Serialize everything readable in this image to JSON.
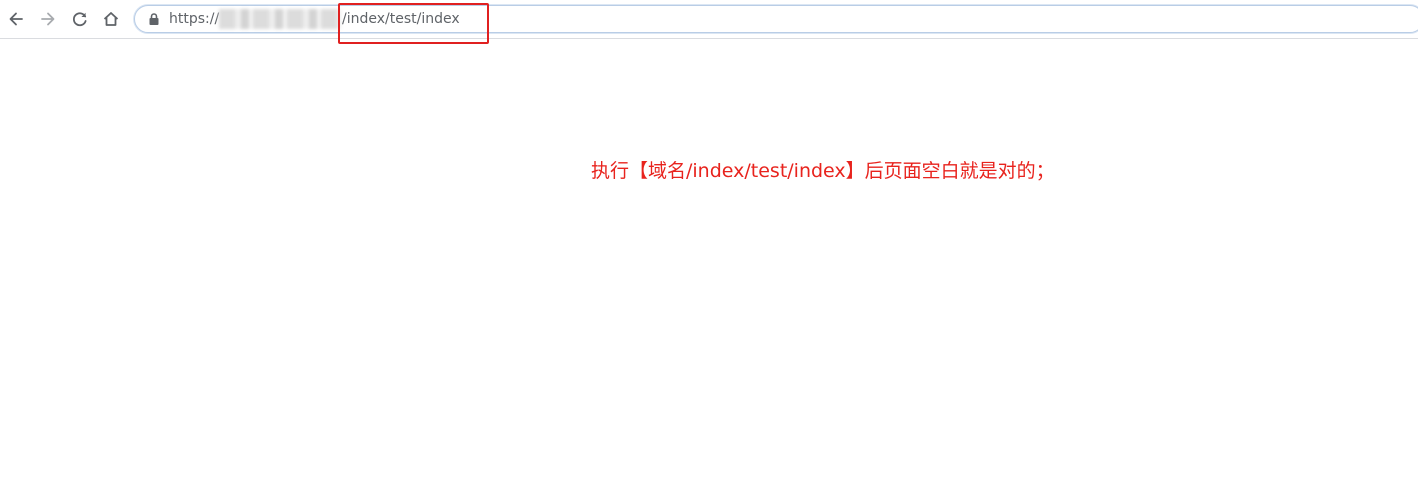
{
  "browser": {
    "icons": {
      "back": "back-arrow-icon",
      "forward": "forward-arrow-icon",
      "reload": "reload-icon",
      "home": "home-icon",
      "lock": "lock-icon"
    },
    "address_bar": {
      "scheme_prefix": "https://",
      "path": "/index/test/index"
    }
  },
  "annotation": {
    "text": "执行【域名/index/test/index】后页面空白就是对的；",
    "color": "#e8231d"
  },
  "highlight_box_color": "#e02020"
}
